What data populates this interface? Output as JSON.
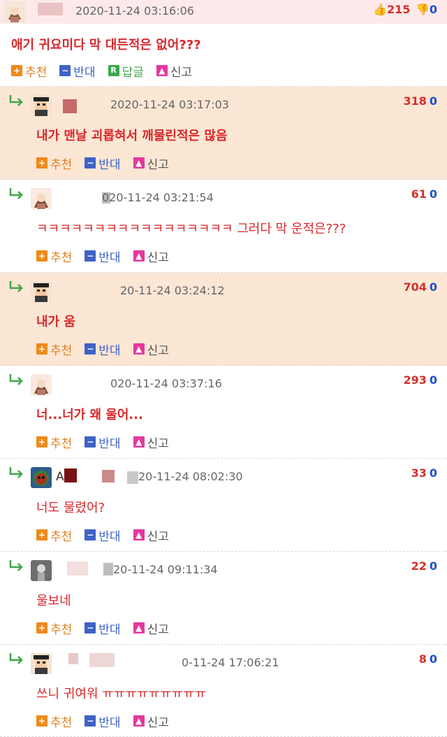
{
  "actions": {
    "recommend": "추천",
    "oppose": "반대",
    "reply": "답글",
    "report": "신고",
    "reply_badge": "R"
  },
  "comments": [
    {
      "author": "",
      "date": "2020-11-24 03:16:06",
      "text": "애기 귀요미다 막 대든적은 없어???",
      "up": "215",
      "down": "0",
      "is_reply": false,
      "highlighted": false
    },
    {
      "author": "",
      "date": "2020-11-24 03:17:03",
      "text": "내가 맨날 괴롭혀서 깨물린적은 많음",
      "up": "318",
      "down": "0",
      "is_reply": true,
      "highlighted": true
    },
    {
      "author": "",
      "date": "020-11-24 03:21:54",
      "text": "ㅋㅋㅋㅋㅋㅋㅋㅋㅋㅋㅋㅋㅋㅋㅋㅋㅋ 그러다 막 운적은???",
      "up": "61",
      "down": "0",
      "is_reply": true,
      "highlighted": false
    },
    {
      "author": "",
      "date": "20-11-24 03:24:12",
      "text": "내가 움",
      "up": "704",
      "down": "0",
      "is_reply": true,
      "highlighted": true
    },
    {
      "author": "",
      "date": "020-11-24 03:37:16",
      "text": "너...너가 왜 울어...",
      "up": "293",
      "down": "0",
      "is_reply": true,
      "highlighted": false
    },
    {
      "author": "A",
      "date": "20-11-24 08:02:30",
      "text": "너도 물렸어?",
      "up": "33",
      "down": "0",
      "is_reply": true,
      "highlighted": false
    },
    {
      "author": "",
      "date": "20-11-24 09:11:34",
      "text": "울보네",
      "up": "22",
      "down": "0",
      "is_reply": true,
      "highlighted": false
    },
    {
      "author": "",
      "date": "0-11-24 17:06:21",
      "text": "쓰니 귀여워 ㅠㅠㅠㅠㅠㅠㅠㅠㅠ",
      "up": "8",
      "down": "0",
      "is_reply": true,
      "highlighted": false
    }
  ]
}
